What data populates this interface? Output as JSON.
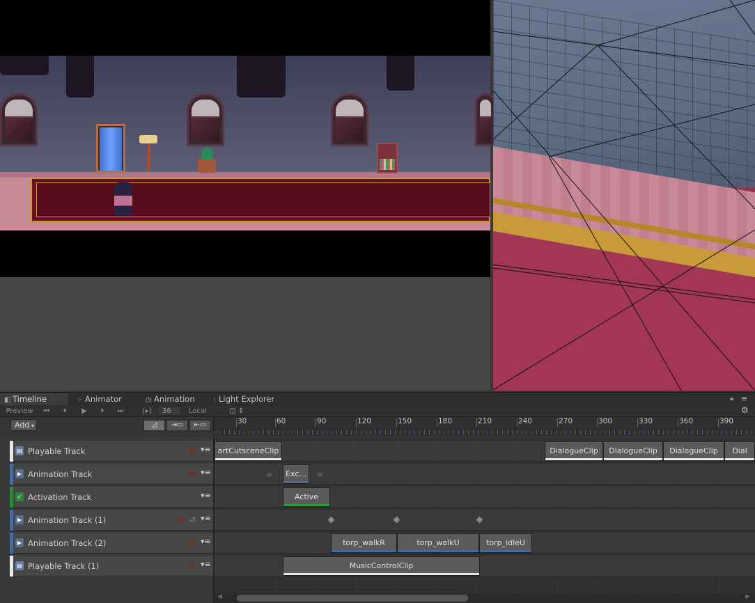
{
  "tabs": [
    {
      "label": "Timeline",
      "icon": "timeline-icon"
    },
    {
      "label": "Animator",
      "icon": "animator-icon"
    },
    {
      "label": "Animation",
      "icon": "clock-icon"
    },
    {
      "label": "Light Explorer",
      "icon": "light-explorer-icon"
    }
  ],
  "toolbar": {
    "preview_label": "Preview",
    "frame_value": "36",
    "space_label": "Local",
    "add_label": "Add"
  },
  "ruler": {
    "ticks": [
      "30",
      "60",
      "90",
      "120",
      "150",
      "180",
      "210",
      "240",
      "270",
      "300",
      "330",
      "360",
      "390"
    ]
  },
  "tracks": [
    {
      "name": "Playable Track",
      "color": "#e8e8e8",
      "icon": "playable-icon"
    },
    {
      "name": "Animation Track",
      "color": "#4a6a9a",
      "icon": "animation-icon"
    },
    {
      "name": "Activation Track",
      "color": "#2e8a3a",
      "icon": "activation-check-icon"
    },
    {
      "name": "Animation Track (1)",
      "color": "#4a6a9a",
      "icon": "animation-icon"
    },
    {
      "name": "Animation Track (2)",
      "color": "#4a6a9a",
      "icon": "animation-icon"
    },
    {
      "name": "Playable Track (1)",
      "color": "#e8e8e8",
      "icon": "playable-icon"
    }
  ],
  "clips": {
    "start_cutscene": "artCutsceneClip",
    "dialogue": [
      "DialogueClip",
      "DialogueClip",
      "DialogueClip",
      "Dial"
    ],
    "exc": "Exc...",
    "active": "Active",
    "walk": [
      "torp_walkR",
      "torp_walkU",
      "torp_idleU"
    ],
    "music": "MusicControlClip"
  }
}
